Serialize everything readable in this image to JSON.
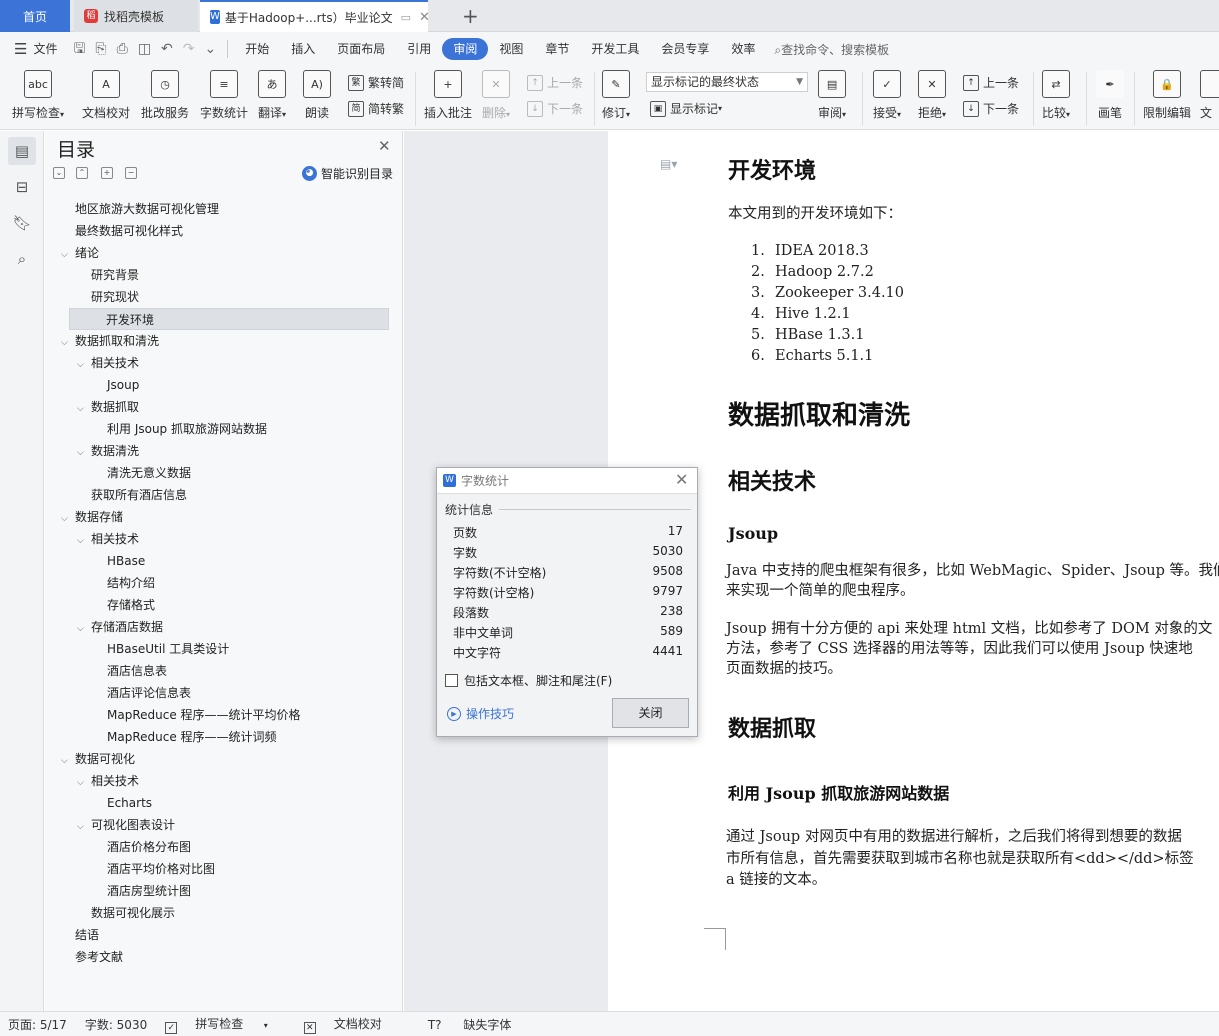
{
  "tabs": [
    {
      "label": "首页"
    },
    {
      "label": "找稻壳模板"
    },
    {
      "label": "基于Hadoop+...rts）毕业论文"
    }
  ],
  "menu": {
    "items": [
      "文件",
      "开始",
      "插入",
      "页面布局",
      "引用",
      "审阅",
      "视图",
      "章节",
      "开发工具",
      "会员专享",
      "效率"
    ],
    "active": "审阅",
    "search_placeholder": "查找命令、搜索模板"
  },
  "ribbon": {
    "spell_check": "拼写检查",
    "doc_proof": "文档校对",
    "batch_service": "批改服务",
    "word_count": "字数统计",
    "translate": "翻译",
    "read_aloud": "朗读",
    "to_traditional": "繁转简",
    "to_simplified": "简转繁",
    "insert_comment": "插入批注",
    "delete": "删除",
    "prev_comment": "上一条",
    "next_comment": "下一条",
    "revise": "修订",
    "markup_state": "显示标记的最终状态",
    "show_markup": "显示标记",
    "review": "审阅",
    "accept": "接受",
    "reject": "拒绝",
    "prev_change": "上一条",
    "next_change": "下一条",
    "compare": "比较",
    "pen": "画笔",
    "restrict_edit": "限制编辑",
    "doc_cut": "文"
  },
  "toc": {
    "title": "目录",
    "smart_label": "智能识别目录",
    "items": [
      {
        "label": "地区旅游大数据可视化管理",
        "level": 0,
        "caret": ""
      },
      {
        "label": "最终数据可视化样式",
        "level": 0,
        "caret": ""
      },
      {
        "label": "绪论",
        "level": 0,
        "caret": "v"
      },
      {
        "label": "研究背景",
        "level": 1,
        "caret": ""
      },
      {
        "label": "研究现状",
        "level": 1,
        "caret": ""
      },
      {
        "label": "开发环境",
        "level": 1,
        "caret": "",
        "selected": true
      },
      {
        "label": "数据抓取和清洗",
        "level": 0,
        "caret": "v"
      },
      {
        "label": "相关技术",
        "level": 1,
        "caret": "v"
      },
      {
        "label": "Jsoup",
        "level": 2,
        "caret": ""
      },
      {
        "label": "数据抓取",
        "level": 1,
        "caret": "v"
      },
      {
        "label": "利用 Jsoup 抓取旅游网站数据",
        "level": 2,
        "caret": ""
      },
      {
        "label": "数据清洗",
        "level": 1,
        "caret": "v"
      },
      {
        "label": "清洗无意义数据",
        "level": 2,
        "caret": ""
      },
      {
        "label": "获取所有酒店信息",
        "level": 1,
        "caret": ""
      },
      {
        "label": "数据存储",
        "level": 0,
        "caret": "v"
      },
      {
        "label": "相关技术",
        "level": 1,
        "caret": "v"
      },
      {
        "label": "HBase",
        "level": 2,
        "caret": ""
      },
      {
        "label": "结构介绍",
        "level": 2,
        "caret": ""
      },
      {
        "label": "存储格式",
        "level": 2,
        "caret": ""
      },
      {
        "label": "存储酒店数据",
        "level": 1,
        "caret": "v"
      },
      {
        "label": "HBaseUtil 工具类设计",
        "level": 2,
        "caret": ""
      },
      {
        "label": "酒店信息表",
        "level": 2,
        "caret": ""
      },
      {
        "label": "酒店评论信息表",
        "level": 2,
        "caret": ""
      },
      {
        "label": "MapReduce 程序——统计平均价格",
        "level": 2,
        "caret": ""
      },
      {
        "label": "MapReduce 程序——统计词频",
        "level": 2,
        "caret": ""
      },
      {
        "label": "数据可视化",
        "level": 0,
        "caret": "v"
      },
      {
        "label": "相关技术",
        "level": 1,
        "caret": "v"
      },
      {
        "label": "Echarts",
        "level": 2,
        "caret": ""
      },
      {
        "label": "可视化图表设计",
        "level": 1,
        "caret": "v"
      },
      {
        "label": "酒店价格分布图",
        "level": 2,
        "caret": ""
      },
      {
        "label": "酒店平均价格对比图",
        "level": 2,
        "caret": ""
      },
      {
        "label": "酒店房型统计图",
        "level": 2,
        "caret": ""
      },
      {
        "label": "数据可视化展示",
        "level": 1,
        "caret": ""
      },
      {
        "label": "结语",
        "level": 0,
        "caret": ""
      },
      {
        "label": "参考文献",
        "level": 0,
        "caret": ""
      }
    ]
  },
  "document": {
    "h_dev_env": "开发环境",
    "p_dev_env": "本文用到的开发环境如下：",
    "env_list": [
      "IDEA 2018.3",
      "Hadoop 2.7.2",
      "Zookeeper 3.4.10",
      "Hive 1.2.1",
      "HBase 1.3.1",
      "Echarts 5.1.1"
    ],
    "h_crawl": "数据抓取和清洗",
    "h_related": "相关技术",
    "h_jsoup": "Jsoup",
    "p_jsoup_1a": "Java 中支持的爬虫框架有很多，比如 WebMagic、Spider、Jsoup 等。我们使",
    "p_jsoup_1b": "来实现一个简单的爬虫程序。",
    "p_jsoup_2a": "Jsoup 拥有十分方便的 api 来处理 html 文档，比如参考了 DOM 对象的文",
    "p_jsoup_2b": "方法，参考了 CSS 选择器的用法等等，因此我们可以使用 Jsoup 快速地",
    "p_jsoup_2c": "页面数据的技巧。",
    "h_fetch": "数据抓取",
    "h_fetch_sub": "利用 Jsoup 抓取旅游网站数据",
    "p_fetch_a": "通过 Jsoup 对网页中有用的数据进行解析，之后我们将得到想要的数据",
    "p_fetch_b": "市所有信息，首先需要获取到城市名称也就是获取所有<dd></dd>标签",
    "p_fetch_c": "a 链接的文本。"
  },
  "dialog": {
    "title": "字数统计",
    "section": "统计信息",
    "rows": [
      {
        "label": "页数",
        "value": "17"
      },
      {
        "label": "字数",
        "value": "5030"
      },
      {
        "label": "字符数(不计空格)",
        "value": "9508"
      },
      {
        "label": "字符数(计空格)",
        "value": "9797"
      },
      {
        "label": "段落数",
        "value": "238"
      },
      {
        "label": "非中文单词",
        "value": "589"
      },
      {
        "label": "中文字符",
        "value": "4441"
      }
    ],
    "checkbox_label": "包括文本框、脚注和尾注(F)",
    "tips_label": "操作技巧",
    "close_label": "关闭"
  },
  "status": {
    "page": "页面: 5/17",
    "words": "字数: 5030",
    "spell": "拼写检查",
    "proof": "文档校对",
    "missing_font": "缺失字体"
  },
  "colors": {
    "accent": "#3b74d6",
    "tab_active": "#3b74d6"
  }
}
